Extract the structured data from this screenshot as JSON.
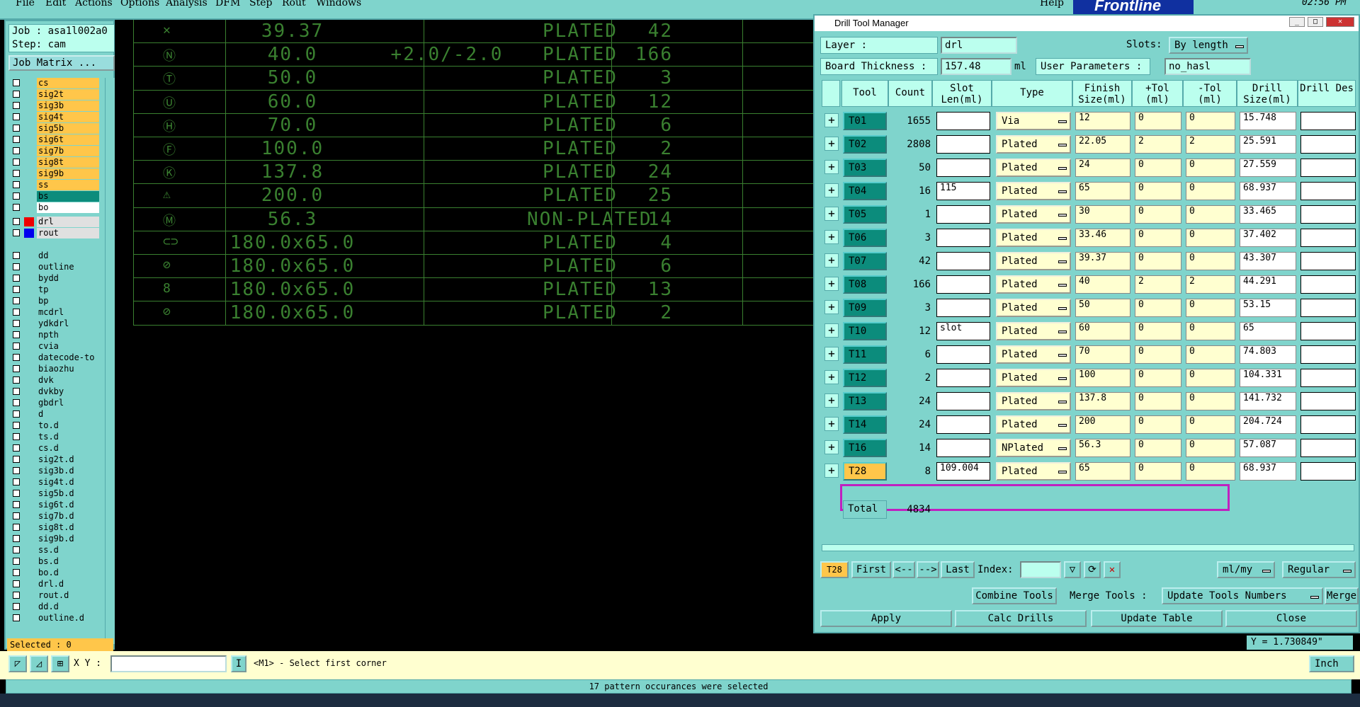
{
  "menu": [
    "File",
    "Edit",
    "Actions",
    "Options",
    "Analysis",
    "DFM",
    "Step",
    "Rout",
    "Windows"
  ],
  "help": "Help",
  "brand": "Frontline",
  "clock": "02:56 PM",
  "left": {
    "job": "Job : asa1l002a0",
    "step": "Step: cam",
    "job_matrix": "Job Matrix ...",
    "selected": "Selected : 0",
    "layers": [
      {
        "name": "cs",
        "style": "orange"
      },
      {
        "name": "sig2t",
        "style": "orange"
      },
      {
        "name": "sig3b",
        "style": "orange"
      },
      {
        "name": "sig4t",
        "style": "orange"
      },
      {
        "name": "sig5b",
        "style": "orange"
      },
      {
        "name": "sig6t",
        "style": "orange"
      },
      {
        "name": "sig7b",
        "style": "orange"
      },
      {
        "name": "sig8t",
        "style": "orange"
      },
      {
        "name": "sig9b",
        "style": "orange"
      },
      {
        "name": "ss",
        "style": "orange"
      },
      {
        "name": "bs",
        "style": "teal"
      },
      {
        "name": "bo",
        "style": "white"
      },
      {
        "name": "drl",
        "style": "grey"
      },
      {
        "name": "rout",
        "style": "grey"
      },
      {
        "name": "dd",
        "style": "cyan"
      },
      {
        "name": "outline",
        "style": "cyan"
      },
      {
        "name": "bydd",
        "style": "cyan"
      },
      {
        "name": "tp",
        "style": "cyan"
      },
      {
        "name": "bp",
        "style": "cyan"
      },
      {
        "name": "mcdrl",
        "style": "cyan"
      },
      {
        "name": "ydkdrl",
        "style": "cyan"
      },
      {
        "name": "npth",
        "style": "cyan"
      },
      {
        "name": "cvia",
        "style": "cyan"
      },
      {
        "name": "datecode-to",
        "style": "cyan"
      },
      {
        "name": "biaozhu",
        "style": "cyan"
      },
      {
        "name": "dvk",
        "style": "cyan"
      },
      {
        "name": "dvkby",
        "style": "cyan"
      },
      {
        "name": "gbdrl",
        "style": "cyan"
      },
      {
        "name": "d",
        "style": "cyan"
      },
      {
        "name": "to.d",
        "style": "cyan"
      },
      {
        "name": "ts.d",
        "style": "cyan"
      },
      {
        "name": "cs.d",
        "style": "cyan"
      },
      {
        "name": "sig2t.d",
        "style": "cyan"
      },
      {
        "name": "sig3b.d",
        "style": "cyan"
      },
      {
        "name": "sig4t.d",
        "style": "cyan"
      },
      {
        "name": "sig5b.d",
        "style": "cyan"
      },
      {
        "name": "sig6t.d",
        "style": "cyan"
      },
      {
        "name": "sig7b.d",
        "style": "cyan"
      },
      {
        "name": "sig8t.d",
        "style": "cyan"
      },
      {
        "name": "sig9b.d",
        "style": "cyan"
      },
      {
        "name": "ss.d",
        "style": "cyan"
      },
      {
        "name": "bs.d",
        "style": "cyan"
      },
      {
        "name": "bo.d",
        "style": "cyan"
      },
      {
        "name": "drl.d",
        "style": "cyan"
      },
      {
        "name": "rout.d",
        "style": "cyan"
      },
      {
        "name": "dd.d",
        "style": "cyan"
      },
      {
        "name": "outline.d",
        "style": "cyan"
      }
    ]
  },
  "canvas_rows": [
    {
      "sym": "✕",
      "size": "39.37",
      "tol": "",
      "type": "PLATED",
      "count": "42"
    },
    {
      "sym": "Ⓝ",
      "size": "40.0",
      "tol": "+2.0/-2.0",
      "type": "PLATED",
      "count": "166"
    },
    {
      "sym": "Ⓣ",
      "size": "50.0",
      "tol": "",
      "type": "PLATED",
      "count": "3"
    },
    {
      "sym": "Ⓤ",
      "size": "60.0",
      "tol": "",
      "type": "PLATED",
      "count": "12"
    },
    {
      "sym": "Ⓗ",
      "size": "70.0",
      "tol": "",
      "type": "PLATED",
      "count": "6"
    },
    {
      "sym": "Ⓕ",
      "size": "100.0",
      "tol": "",
      "type": "PLATED",
      "count": "2"
    },
    {
      "sym": "Ⓚ",
      "size": "137.8",
      "tol": "",
      "type": "PLATED",
      "count": "24"
    },
    {
      "sym": "⚠",
      "size": "200.0",
      "tol": "",
      "type": "PLATED",
      "count": "25"
    },
    {
      "sym": "Ⓜ",
      "size": "56.3",
      "tol": "",
      "type": "NON-PLATED",
      "count": "14"
    },
    {
      "sym": "⊂⊃",
      "size": "180.0x65.0",
      "tol": "",
      "type": "PLATED",
      "count": "4"
    },
    {
      "sym": "⊘",
      "size": "180.0x65.0",
      "tol": "",
      "type": "PLATED",
      "count": "6"
    },
    {
      "sym": "8",
      "size": "180.0x65.0",
      "tol": "",
      "type": "PLATED",
      "count": "13"
    },
    {
      "sym": "⊘",
      "size": "180.0x65.0",
      "tol": "",
      "type": "PLATED",
      "count": "2"
    }
  ],
  "dtm": {
    "title": "Drill Tool Manager",
    "layer_label": "Layer              :",
    "layer_value": "drl",
    "slots_label": "Slots:",
    "slots_value": "By length",
    "board_thickness_label": "Board Thickness  :",
    "board_thickness_value": "157.48",
    "ml": "ml",
    "user_params_label": "User Parameters  :",
    "user_params_value": "no_hasl",
    "headers": {
      "tool": "Tool",
      "count": "Count",
      "slot": "Slot Len(ml)",
      "type": "Type",
      "finish": "Finish Size(ml)",
      "ptol": "+Tol (ml)",
      "ntol": "-Tol (ml)",
      "drill": "Drill Size(ml)",
      "des": "Drill Des"
    },
    "rows": [
      {
        "tool": "T01",
        "count": "1655",
        "slot": "",
        "type": "Via",
        "finish": "12",
        "ptol": "0",
        "ntol": "0",
        "drill": "15.748"
      },
      {
        "tool": "T02",
        "count": "2808",
        "slot": "",
        "type": "Plated",
        "finish": "22.05",
        "ptol": "2",
        "ntol": "2",
        "drill": "25.591"
      },
      {
        "tool": "T03",
        "count": "50",
        "slot": "",
        "type": "Plated",
        "finish": "24",
        "ptol": "0",
        "ntol": "0",
        "drill": "27.559"
      },
      {
        "tool": "T04",
        "count": "16",
        "slot": "115",
        "type": "Plated",
        "finish": "65",
        "ptol": "0",
        "ntol": "0",
        "drill": "68.937"
      },
      {
        "tool": "T05",
        "count": "1",
        "slot": "",
        "type": "Plated",
        "finish": "30",
        "ptol": "0",
        "ntol": "0",
        "drill": "33.465"
      },
      {
        "tool": "T06",
        "count": "3",
        "slot": "",
        "type": "Plated",
        "finish": "33.46",
        "ptol": "0",
        "ntol": "0",
        "drill": "37.402"
      },
      {
        "tool": "T07",
        "count": "42",
        "slot": "",
        "type": "Plated",
        "finish": "39.37",
        "ptol": "0",
        "ntol": "0",
        "drill": "43.307"
      },
      {
        "tool": "T08",
        "count": "166",
        "slot": "",
        "type": "Plated",
        "finish": "40",
        "ptol": "2",
        "ntol": "2",
        "drill": "44.291"
      },
      {
        "tool": "T09",
        "count": "3",
        "slot": "",
        "type": "Plated",
        "finish": "50",
        "ptol": "0",
        "ntol": "0",
        "drill": "53.15"
      },
      {
        "tool": "T10",
        "count": "12",
        "slot": "slot",
        "type": "Plated",
        "finish": "60",
        "ptol": "0",
        "ntol": "0",
        "drill": "65"
      },
      {
        "tool": "T11",
        "count": "6",
        "slot": "",
        "type": "Plated",
        "finish": "70",
        "ptol": "0",
        "ntol": "0",
        "drill": "74.803"
      },
      {
        "tool": "T12",
        "count": "2",
        "slot": "",
        "type": "Plated",
        "finish": "100",
        "ptol": "0",
        "ntol": "0",
        "drill": "104.331"
      },
      {
        "tool": "T13",
        "count": "24",
        "slot": "",
        "type": "Plated",
        "finish": "137.8",
        "ptol": "0",
        "ntol": "0",
        "drill": "141.732"
      },
      {
        "tool": "T14",
        "count": "24",
        "slot": "",
        "type": "Plated",
        "finish": "200",
        "ptol": "0",
        "ntol": "0",
        "drill": "204.724"
      },
      {
        "tool": "T16",
        "count": "14",
        "slot": "",
        "type": "NPlated",
        "finish": "56.3",
        "ptol": "0",
        "ntol": "0",
        "drill": "57.087"
      },
      {
        "tool": "T28",
        "count": "8",
        "slot": "109.004",
        "type": "Plated",
        "finish": "65",
        "ptol": "0",
        "ntol": "0",
        "drill": "68.937"
      }
    ],
    "total_label": "Total",
    "total_value": "4834",
    "current_tool": "T28",
    "nav": {
      "first": "First",
      "prev": "<--",
      "next": "-->",
      "last": "Last",
      "index": "Index:"
    },
    "units": "ml/my",
    "mode": "Regular",
    "combine": "Combine Tools",
    "merge_label": "Merge Tools :",
    "update_numbers": "Update Tools Numbers",
    "merge": "Merge",
    "apply": "Apply",
    "calc": "Calc Drills",
    "update_table": "Update Table",
    "close": "Close"
  },
  "coords": "Y = 1.730849\"",
  "status": {
    "xy_label": "X Y :",
    "prompt": "<M1> - Select first corner",
    "units": "Inch",
    "message": "17 pattern occurances were selected"
  },
  "colors": {
    "panel": "#7fd4cc",
    "highlight": "#c020c0",
    "canvas_line": "#3a8030"
  }
}
